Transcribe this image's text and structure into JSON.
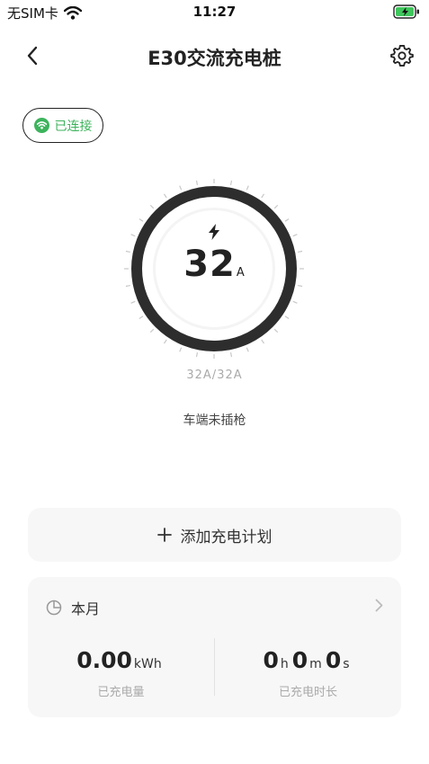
{
  "status_bar": {
    "carrier": "无SIM卡",
    "time": "11:27",
    "wifi_icon": "wifi-icon",
    "battery_icon": "battery-charging-icon"
  },
  "nav": {
    "title": "E30交流充电桩",
    "back_icon": "chevron-left-icon",
    "settings_icon": "gear-icon"
  },
  "connection": {
    "label": "已连接",
    "icon": "wifi-icon",
    "color": "#3db35c"
  },
  "gauge": {
    "icon": "lightning-bolt-icon",
    "value": "32",
    "unit": "A",
    "limit_text": "32A/32A",
    "ring_color": "#2d2d2d"
  },
  "plug_status": "车端未插枪",
  "plan": {
    "icon": "plus-icon",
    "label": "添加充电计划"
  },
  "stats": {
    "icon": "pie-chart-icon",
    "period": "本月",
    "chevron_icon": "chevron-right-icon",
    "energy": {
      "value": "0.00",
      "unit": "kWh",
      "label": "已充电量"
    },
    "duration": {
      "hours": "0",
      "hours_unit": "h",
      "minutes": "0",
      "minutes_unit": "m",
      "seconds": "0",
      "seconds_unit": "s",
      "label": "已充电时长"
    }
  }
}
